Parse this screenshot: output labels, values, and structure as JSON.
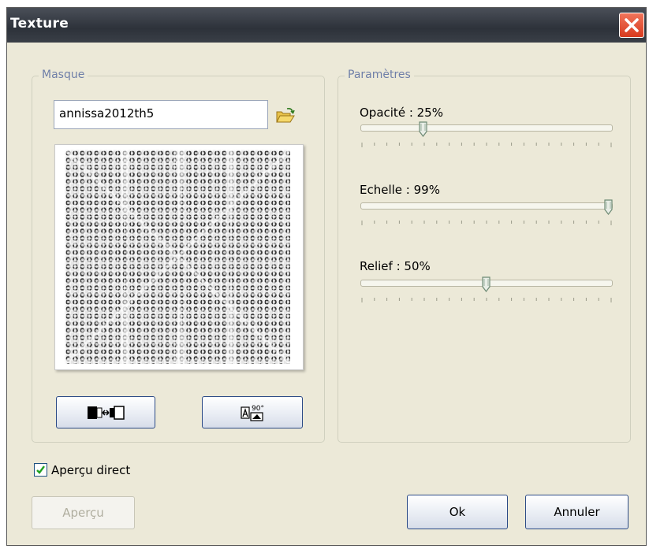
{
  "window": {
    "title": "Texture"
  },
  "masque": {
    "legend": "Masque",
    "file_value": "annissa2012th5",
    "browse_icon": "open-folder-icon",
    "flip_button_icon": "flip-horizontal-icon",
    "rotate_button_icon": "rotate-90-icon"
  },
  "parametres": {
    "legend": "Paramètres",
    "sliders": [
      {
        "label": "Opacité : 25%",
        "value_percent": 25
      },
      {
        "label": "Echelle : 99%",
        "value_percent": 99
      },
      {
        "label": "Relief : 50%",
        "value_percent": 50
      }
    ]
  },
  "apercu_direct": {
    "label": "Aperçu direct",
    "checked": true
  },
  "buttons": {
    "apercu": "Aperçu",
    "ok": "Ok",
    "annuler": "Annuler"
  },
  "colors": {
    "titlebar": "#2d323a",
    "close": "#d83a1e",
    "dialog_bg": "#ece9d8",
    "legend_text": "#6f7fa8",
    "check": "#21a121"
  }
}
